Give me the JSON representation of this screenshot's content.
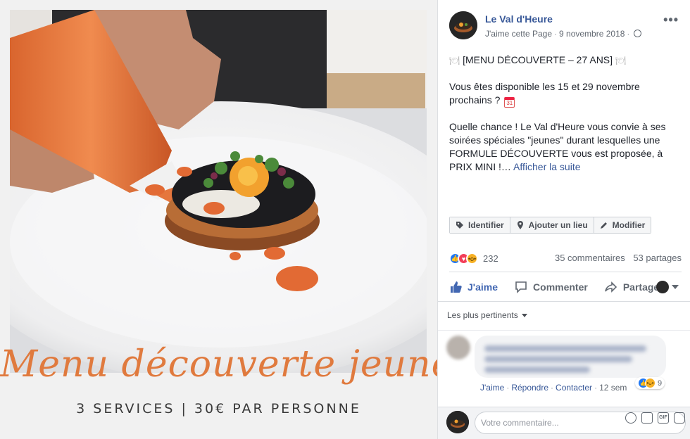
{
  "image_overlay": {
    "title": "Menu découverte jeunes",
    "subtitle": "3 SERVICES | 30€ PAR PERSONNE"
  },
  "post": {
    "page_name": "Le Val d'Heure",
    "like_page": "J'aime cette Page",
    "date": "9 novembre 2018",
    "more_menu": "•••",
    "title_line": "[MENU DÉCOUVERTE – 27 ANS]",
    "para2": "Vous êtes disponible les 15 et 29 novembre prochains ?",
    "para3": "Quelle chance ! Le Val d'Heure vous convie à ses soirées spéciales \"jeunes\" durant lesquelles une FORMULE DÉCOUVERTE vous est proposée, à PRIX MINI !…",
    "see_more": "Afficher la suite",
    "tag_buttons": [
      "Identifier",
      "Ajouter un lieu",
      "Modifier"
    ],
    "reaction_count": "232",
    "comments_count": "35 commentaires",
    "shares_count": "53 partages",
    "actions": {
      "like": "J'aime",
      "comment": "Commenter",
      "share": "Partager"
    }
  },
  "comments": {
    "sort_label": "Les plus pertinents",
    "first": {
      "actions": [
        "J'aime",
        "Répondre",
        "Contacter"
      ],
      "time": "12 sem",
      "reaction_count": "9"
    },
    "composer_placeholder": "Votre commentaire..."
  },
  "colors": {
    "link": "#385898",
    "accent": "#4267b2",
    "brand_orange": "#e07a3e"
  }
}
